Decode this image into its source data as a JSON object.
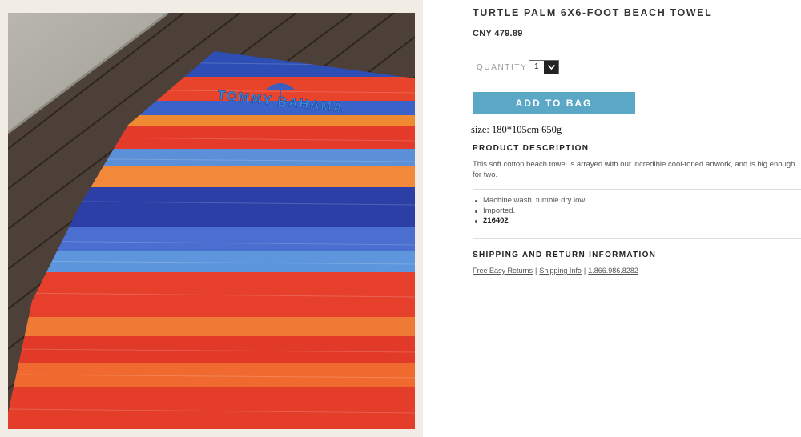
{
  "product": {
    "title": "TURTLE PALM 6X6-FOOT BEACH TOWEL",
    "price": "CNY 479.89",
    "image_alt": "Striped red and blue beach towel on wooden deck",
    "towel_print_text": "TOMMY BAHAMA"
  },
  "quantity": {
    "label": "QUANTITY",
    "value": "1"
  },
  "add_to_bag": {
    "label": "ADD TO BAG",
    "color": "#5ba7c6"
  },
  "size_line": "size:  180*105cm  650g",
  "description": {
    "heading": "PRODUCT DESCRIPTION",
    "text": "This soft cotton beach towel is arrayed with our incredible cool-toned artwork, and is big enough for two.",
    "bullets": [
      "Machine wash, tumble dry low.",
      "Imported.",
      "216402"
    ]
  },
  "shipping": {
    "heading": "SHIPPING AND RETURN INFORMATION",
    "links": [
      "Free Easy Returns",
      "Shipping Info",
      "1.866.986.8282"
    ],
    "separator": "|"
  },
  "icons": {
    "dropdown": "chevron-down-icon"
  }
}
